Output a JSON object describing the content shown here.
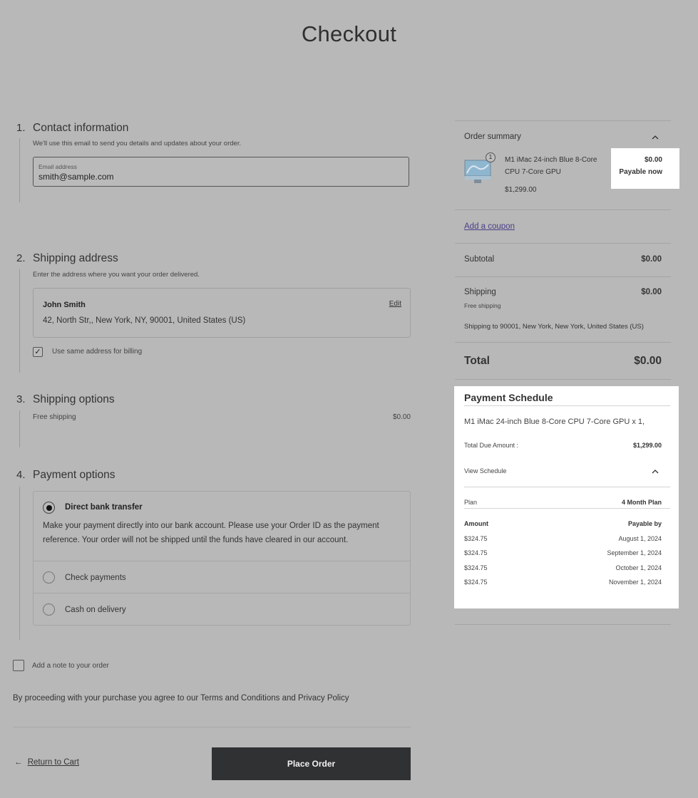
{
  "page": {
    "title": "Checkout"
  },
  "steps": {
    "contact": {
      "number": "1.",
      "title": "Contact information",
      "description": "We'll use this email to send you details and updates about your order.",
      "email_label": "Email address",
      "email_value": "smith@sample.com"
    },
    "shipping_address": {
      "number": "2.",
      "title": "Shipping address",
      "description": "Enter the address where you want your order delivered.",
      "name": "John Smith",
      "address": "42, North Str,, New York, NY, 90001, United States (US)",
      "edit_label": "Edit",
      "billing_checkbox_label": "Use same address for billing",
      "billing_checked": true
    },
    "shipping_options": {
      "number": "3.",
      "title": "Shipping options",
      "option_label": "Free shipping",
      "option_price": "$0.00"
    },
    "payment_options": {
      "number": "4.",
      "title": "Payment options",
      "methods": [
        {
          "label": "Direct bank transfer",
          "selected": true
        },
        {
          "label": "Check payments",
          "selected": false
        },
        {
          "label": "Cash on delivery",
          "selected": false
        }
      ],
      "bank_description_line1": "Make your payment directly into our bank account. Please use your Order ID as the payment",
      "bank_description_line2": "reference. Your order will not be shipped until the funds have cleared in our account."
    }
  },
  "note": {
    "label": "Add a note to your order"
  },
  "terms": "By proceeding with your purchase you agree to our Terms and Conditions and Privacy Policy",
  "footer": {
    "return_arrow": "←",
    "return_label": "Return to Cart",
    "place_order_label": "Place Order"
  },
  "order_summary": {
    "title": "Order summary",
    "collapse_icon": "chevron-up-icon",
    "item": {
      "name_line1": "M1 iMac 24-inch Blue 8-Core",
      "name_line2": "CPU 7-Core GPU",
      "unit_price": "$1,299.00",
      "quantity": "1",
      "price": "$0.00",
      "price_note": "Payable now"
    },
    "coupon_label": "Add a coupon",
    "subtotal_label": "Subtotal",
    "subtotal_value": "$0.00",
    "shipping_label": "Shipping",
    "shipping_value": "$0.00",
    "shipping_method": "Free shipping",
    "shipping_destination": "Shipping to 90001, New York, New York, United States (US)",
    "total_label": "Total",
    "total_value": "$0.00"
  },
  "payment_schedule": {
    "title": "Payment Schedule",
    "product_line": "M1 iMac 24-inch Blue 8-Core CPU 7-Core GPU x 1,",
    "total_due_label": "Total Due Amount :",
    "total_due_value": "$1,299.00",
    "view_schedule_label": "View Schedule",
    "plan_label": "Plan",
    "plan_value": "4 Month Plan",
    "amount_header": "Amount",
    "payable_by_header": "Payable by",
    "rows": [
      {
        "amount": "$324.75",
        "date": "August 1, 2024"
      },
      {
        "amount": "$324.75",
        "date": "September 1, 2024"
      },
      {
        "amount": "$324.75",
        "date": "October 1, 2024"
      },
      {
        "amount": "$324.75",
        "date": "November 1, 2024"
      }
    ]
  }
}
